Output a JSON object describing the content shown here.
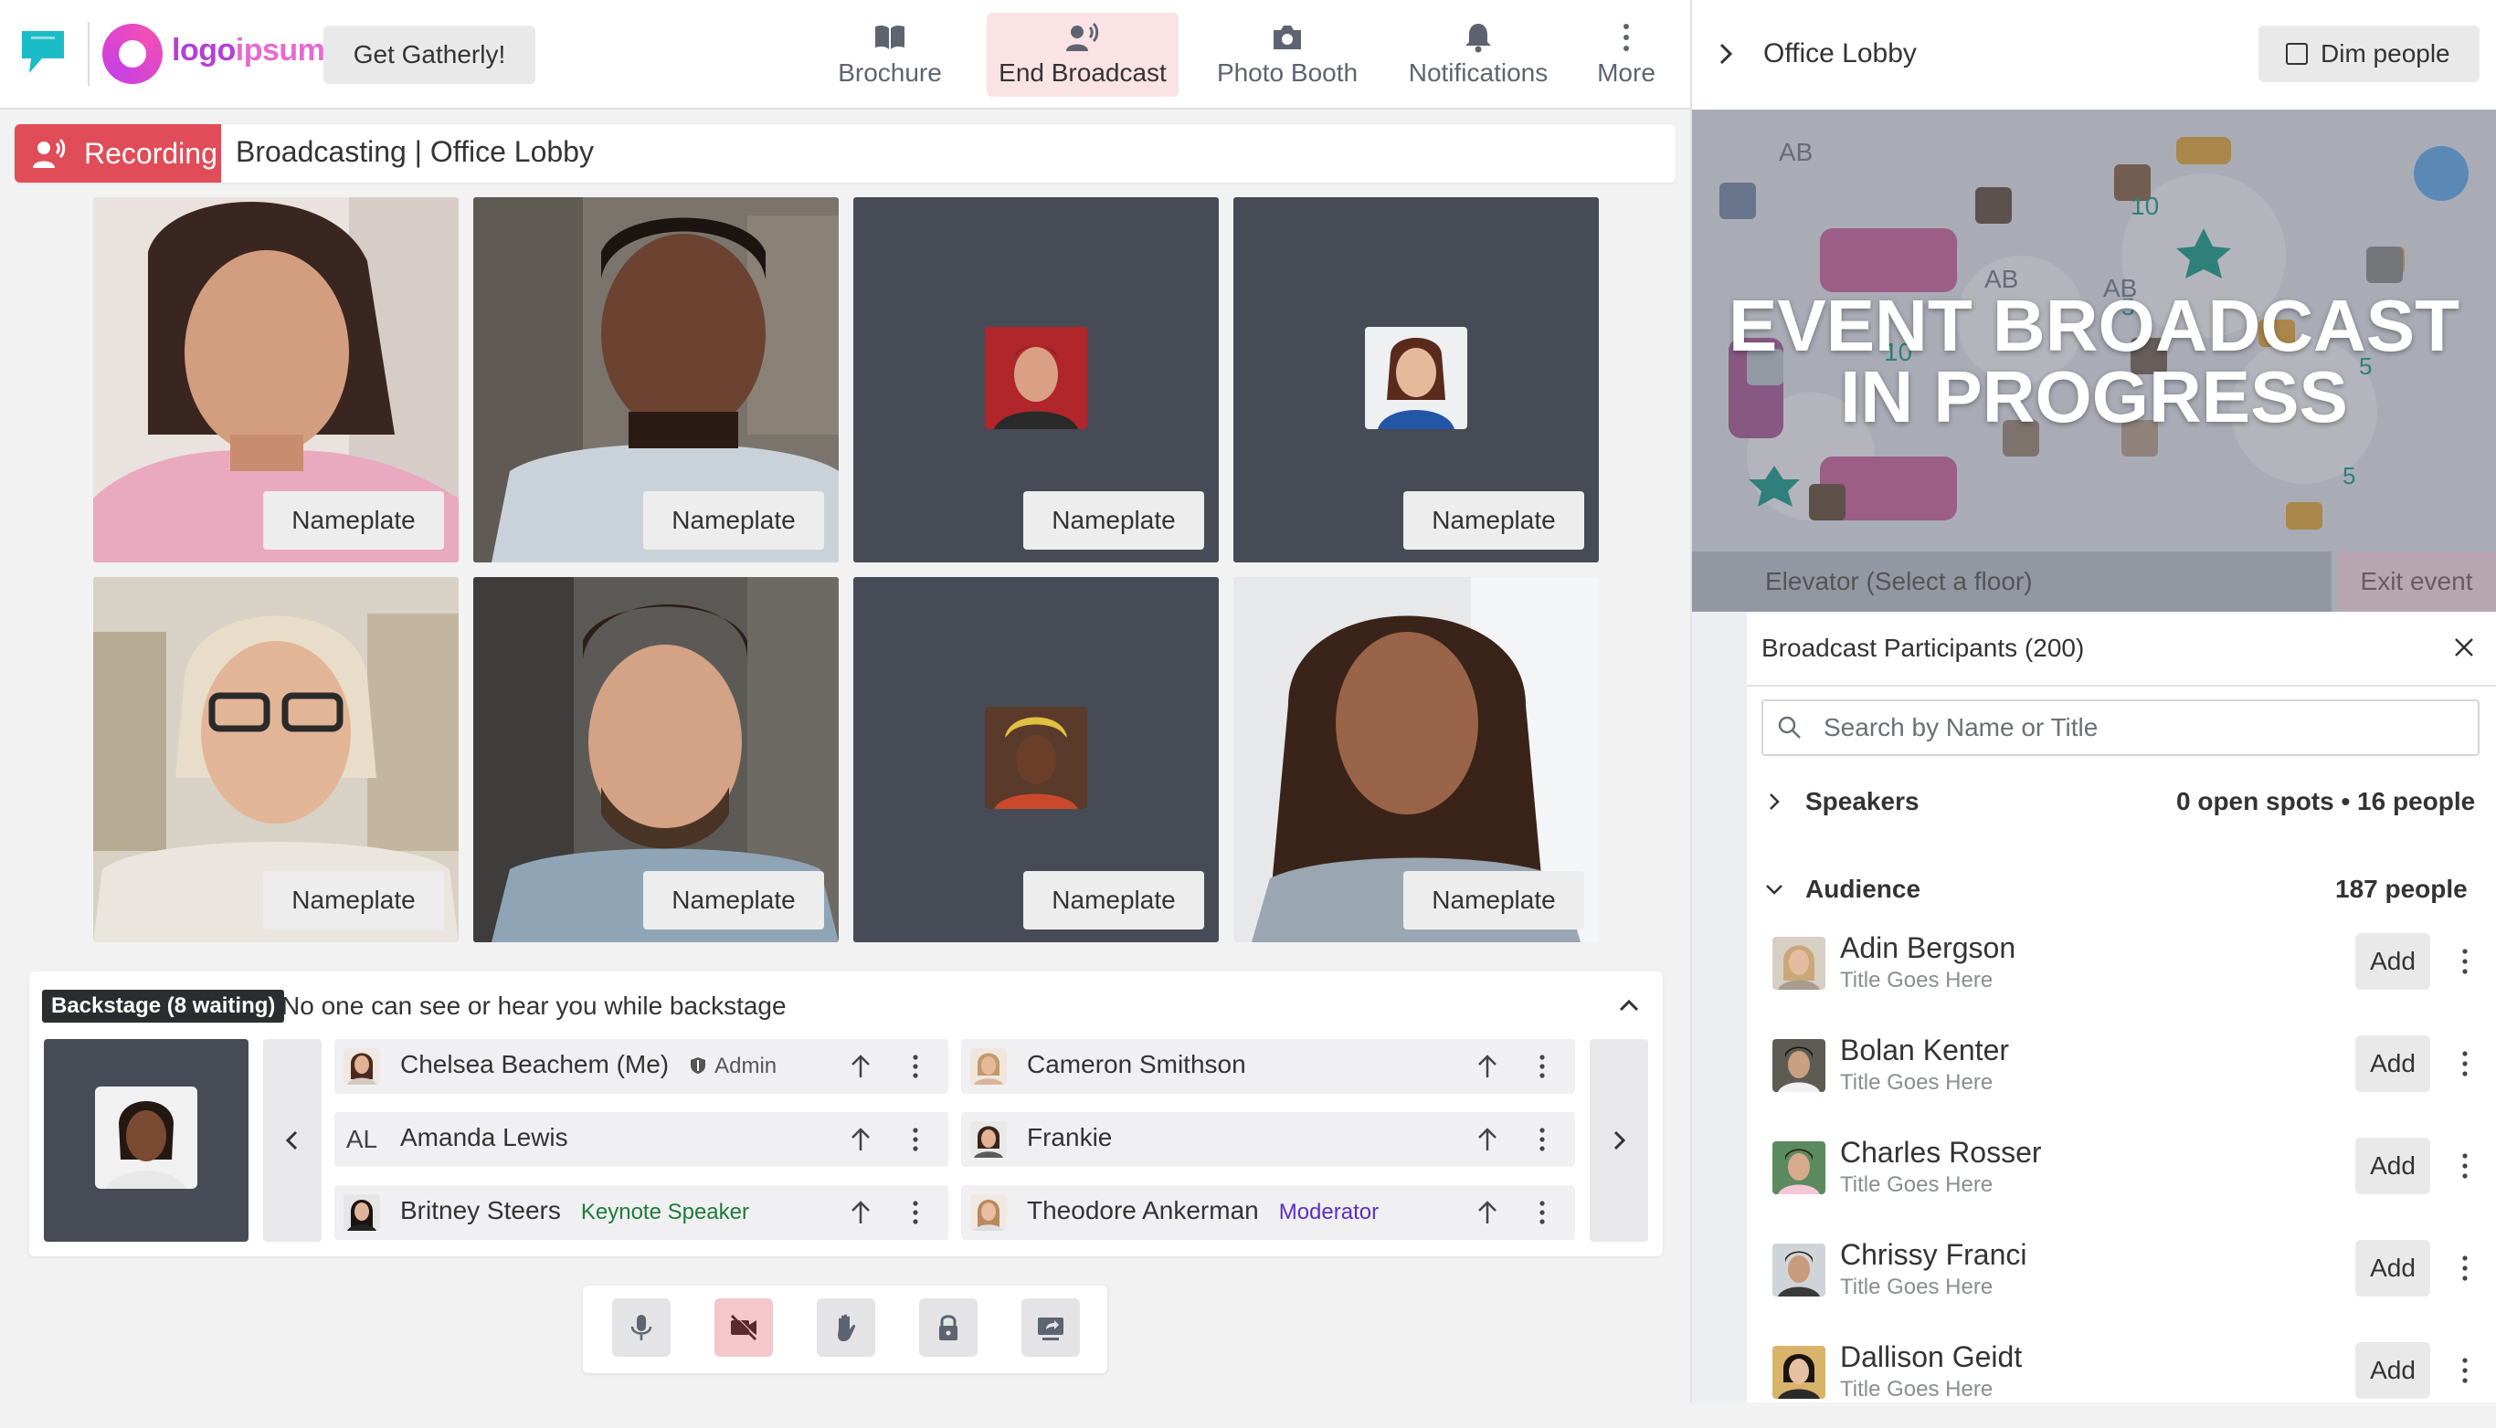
{
  "header": {
    "logo_word_1": "logo",
    "logo_word_2": "ipsum",
    "cta_button": "Get Gatherly!",
    "nav": {
      "brochure": "Brochure",
      "end_broadcast": "End Broadcast",
      "photo_booth": "Photo Booth",
      "notifications": "Notifications",
      "more": "More"
    }
  },
  "recording": {
    "badge": "Recording",
    "title": "Broadcasting | Office Lobby"
  },
  "stage": {
    "nameplate_label": "Nameplate",
    "tiles": [
      "Nameplate",
      "Nameplate",
      "Nameplate",
      "Nameplate",
      "Nameplate",
      "Nameplate",
      "Nameplate",
      "Nameplate"
    ]
  },
  "backstage": {
    "badge": "Backstage (8 waiting)",
    "message": "No one can see or hear you while backstage",
    "people": [
      {
        "name": "Chelsea Beachem (Me)",
        "tag": "Admin",
        "tag_color": "#555555"
      },
      {
        "name": "Amanda Lewis",
        "initials": "AL",
        "tag": ""
      },
      {
        "name": "Britney Steers",
        "tag": "Keynote Speaker",
        "tag_color": "#1f7a3a"
      },
      {
        "name": "Cameron Smithson",
        "tag": ""
      },
      {
        "name": "Frankie",
        "tag": ""
      },
      {
        "name": "Theodore Ankerman",
        "tag": "Moderator",
        "tag_color": "#5a2fc2"
      }
    ]
  },
  "controls": [
    "microphone",
    "camera-off",
    "raise-hand",
    "lock",
    "share-screen"
  ],
  "right_panel": {
    "room": "Office Lobby",
    "dim_people": "Dim people",
    "map_banner_line1": "EVENT BROADCAST",
    "map_banner_line2": "IN PROGRESS",
    "map_labels": [
      "AB",
      "AB",
      "AB",
      "10",
      "10",
      "5",
      "5",
      "5"
    ],
    "elevator": "Elevator (Select a floor)",
    "exit": "Exit event"
  },
  "participants": {
    "title": "Broadcast Participants (200)",
    "search_placeholder": "Search by Name or Title",
    "speakers_label": "Speakers",
    "speakers_count": "0 open spots • 16 people",
    "audience_label": "Audience",
    "audience_count": "187 people",
    "add_label": "Add",
    "audience": [
      {
        "name": "Adin Bergson",
        "title": "Title Goes Here"
      },
      {
        "name": "Bolan Kenter",
        "title": "Title Goes Here"
      },
      {
        "name": "Charles Rosser",
        "title": "Title Goes Here"
      },
      {
        "name": "Chrissy Franci",
        "title": "Title Goes Here"
      },
      {
        "name": "Dallison Geidt",
        "title": "Title Goes Here"
      }
    ]
  },
  "colors": {
    "recording_red": "#e04c58",
    "end_broadcast_bg": "#fbe3e5",
    "tile_dark": "#474b55",
    "brand_pink": "#e66ad0",
    "brand_purple": "#b43fd8",
    "chat_logo": "#1bbcc8"
  }
}
